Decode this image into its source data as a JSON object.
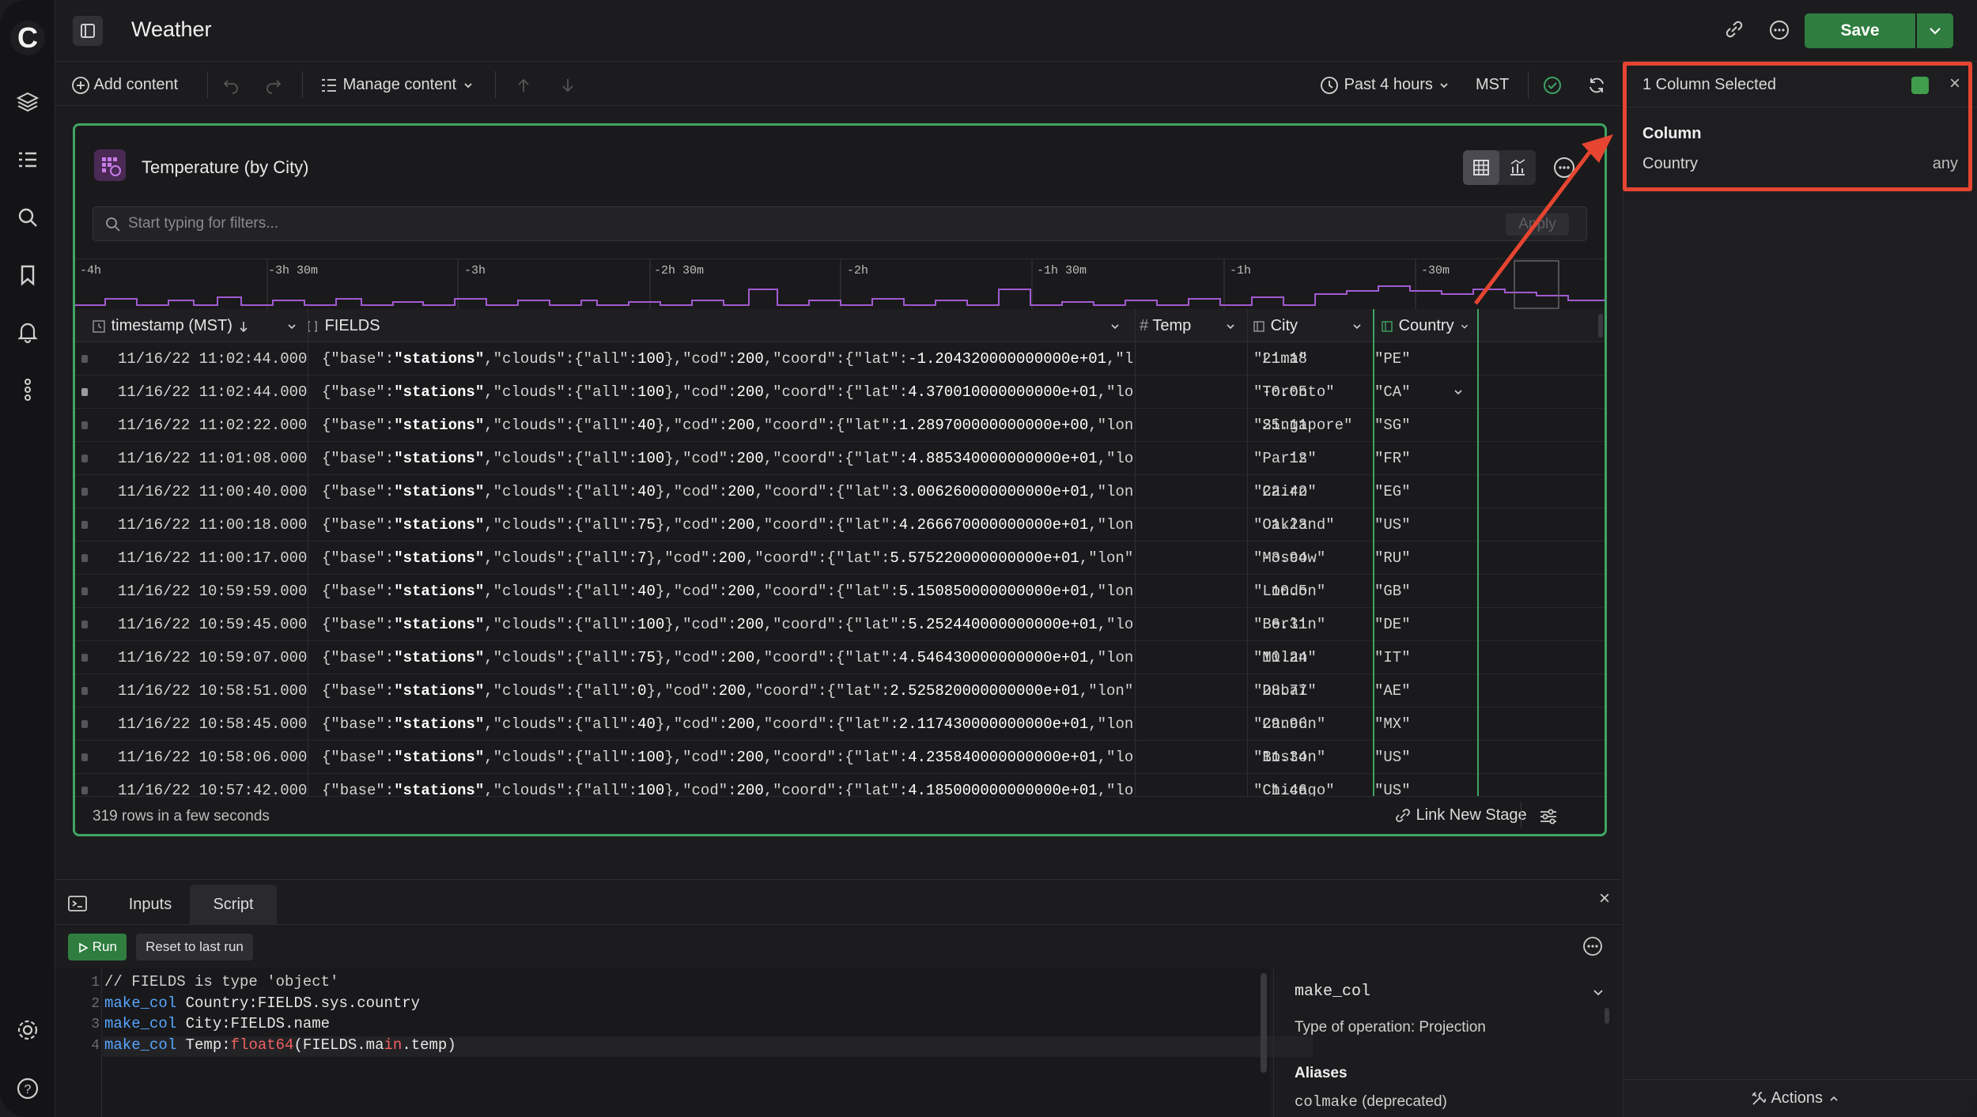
{
  "app": {
    "logo_letter": "C",
    "title": "Weather",
    "save_label": "Save"
  },
  "toolbar": {
    "add_content": "Add content",
    "manage_content": "Manage content",
    "time_range": "Past 4 hours",
    "timezone": "MST"
  },
  "card": {
    "title": "Temperature (by City)",
    "filter_placeholder": "Start typing for filters...",
    "apply_label": "Apply",
    "timeline_labels": [
      "-4h",
      "-3h 30m",
      "-3h",
      "-2h 30m",
      "-2h",
      "-1h 30m",
      "-1h",
      "-30m"
    ],
    "columns": {
      "timestamp": "timestamp (MST)",
      "fields": "FIELDS",
      "temp": "Temp",
      "city": "City",
      "country": "Country"
    },
    "rows": [
      {
        "ts": "11/16/22 11:02:44.000",
        "fields": "{\"base\":\"stations\",\"clouds\":{\"all\":100},\"cod\":200,\"coord\":{\"lat\":-1.204320000000000e+01,\"lon\"…",
        "temp": "21.18",
        "city": "\"Lima\"",
        "country": "\"PE\""
      },
      {
        "ts": "11/16/22 11:02:44.000",
        "fields": "{\"base\":\"stations\",\"clouds\":{\"all\":100},\"cod\":200,\"coord\":{\"lat\":4.370010000000000e+01,\"lon\"…",
        "temp": "-0.05",
        "city": "\"Toronto\"",
        "country": "\"CA\""
      },
      {
        "ts": "11/16/22 11:02:22.000",
        "fields": "{\"base\":\"stations\",\"clouds\":{\"all\":40},\"cod\":200,\"coord\":{\"lat\":1.289700000000000e+00,\"lon\"…",
        "temp": "25.11",
        "city": "\"Singapore\"",
        "country": "\"SG\""
      },
      {
        "ts": "11/16/22 11:01:08.000",
        "fields": "{\"base\":\"stations\",\"clouds\":{\"all\":100},\"cod\":200,\"coord\":{\"lat\":4.885340000000000e+01,\"lon\"…",
        "temp": "12",
        "city": "\"Paris\"",
        "country": "\"FR\""
      },
      {
        "ts": "11/16/22 11:00:40.000",
        "fields": "{\"base\":\"stations\",\"clouds\":{\"all\":40},\"cod\":200,\"coord\":{\"lat\":3.006260000000000e+01,\"lon\"…",
        "temp": "22.42",
        "city": "\"Cairo\"",
        "country": "\"EG\""
      },
      {
        "ts": "11/16/22 11:00:18.000",
        "fields": "{\"base\":\"stations\",\"clouds\":{\"all\":75},\"cod\":200,\"coord\":{\"lat\":4.266670000000000e+01,\"lon\"…",
        "temp": "1.23",
        "city": "\"Oakland\"",
        "country": "\"US\""
      },
      {
        "ts": "11/16/22 11:00:17.000",
        "fields": "{\"base\":\"stations\",\"clouds\":{\"all\":7},\"cod\":200,\"coord\":{\"lat\":5.575220000000000e+01,\"lon\":3…",
        "temp": "-3.94",
        "city": "\"Moscow\"",
        "country": "\"RU\""
      },
      {
        "ts": "11/16/22 10:59:59.000",
        "fields": "{\"base\":\"stations\",\"clouds\":{\"all\":40},\"cod\":200,\"coord\":{\"lat\":5.150850000000000e+01,\"lon\"…",
        "temp": "10.5",
        "city": "\"London\"",
        "country": "\"GB\""
      },
      {
        "ts": "11/16/22 10:59:45.000",
        "fields": "{\"base\":\"stations\",\"clouds\":{\"all\":100},\"cod\":200,\"coord\":{\"lat\":5.252440000000000e+01,\"lon\"…",
        "temp": "6.31",
        "city": "\"Berlin\"",
        "country": "\"DE\""
      },
      {
        "ts": "11/16/22 10:59:07.000",
        "fields": "{\"base\":\"stations\",\"clouds\":{\"all\":75},\"cod\":200,\"coord\":{\"lat\":4.546430000000000e+01,\"lon\"…",
        "temp": "10.24",
        "city": "\"Milan\"",
        "country": "\"IT\""
      },
      {
        "ts": "11/16/22 10:58:51.000",
        "fields": "{\"base\":\"stations\",\"clouds\":{\"all\":0},\"cod\":200,\"coord\":{\"lat\":2.525820000000000e+01,\"lon\":5…",
        "temp": "28.77",
        "city": "\"Dubai\"",
        "country": "\"AE\""
      },
      {
        "ts": "11/16/22 10:58:45.000",
        "fields": "{\"base\":\"stations\",\"clouds\":{\"all\":40},\"cod\":200,\"coord\":{\"lat\":2.117430000000000e+01,\"lon\"…",
        "temp": "29.96",
        "city": "\"Cancún\"",
        "country": "\"MX\""
      },
      {
        "ts": "11/16/22 10:58:06.000",
        "fields": "{\"base\":\"stations\",\"clouds\":{\"all\":100},\"cod\":200,\"coord\":{\"lat\":4.235840000000000e+01,\"lon\"…",
        "temp": "11.34",
        "city": "\"Boston\"",
        "country": "\"US\""
      },
      {
        "ts": "11/16/22 10:57:42.000",
        "fields": "{\"base\":\"stations\",\"clouds\":{\"all\":100},\"cod\":200,\"coord\":{\"lat\":4.185000000000000e+01,\"lon\"…",
        "temp": "1.46",
        "city": "\"Chicago\"",
        "country": "\"US\""
      }
    ],
    "row_count": "319 rows in a few seconds",
    "link_stage": "Link New Stage"
  },
  "right_panel": {
    "header": "1 Column Selected",
    "section": "Column",
    "column_name": "Country",
    "column_type": "any",
    "actions": "Actions"
  },
  "console": {
    "tabs": [
      "Inputs",
      "Script"
    ],
    "run_label": "Run",
    "reset_label": "Reset to last run",
    "code_lines": [
      "// FIELDS is type 'object'",
      "make_col Country:FIELDS.sys.country",
      "make_col City:FIELDS.name",
      "make_col Temp:float64(FIELDS.main.temp)"
    ],
    "doc": {
      "name": "make_col",
      "description": "Type of operation: Projection",
      "aliases_heading": "Aliases",
      "alias": "colmake (deprecated)"
    }
  },
  "colors": {
    "accent_green": "#2f7d3f",
    "selection_green": "#3fa463",
    "callout_red": "#e54531",
    "purple": "#a25ad0"
  }
}
